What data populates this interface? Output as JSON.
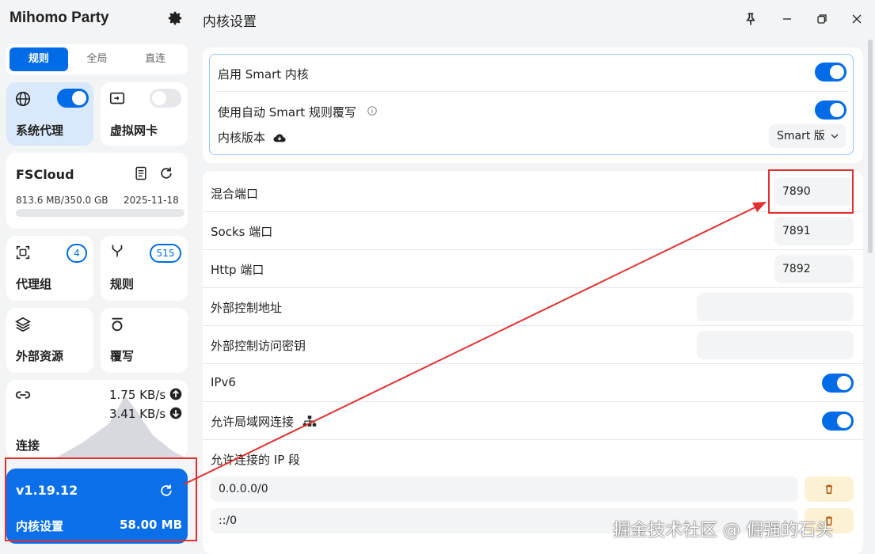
{
  "app": {
    "brand": "Mihomo Party"
  },
  "modes": [
    "规则",
    "全局",
    "直连"
  ],
  "cards": {
    "system_proxy": "系统代理",
    "tun": "虚拟网卡",
    "profile": {
      "name": "FSCloud",
      "usage": "813.6 MB/350.0 GB",
      "date": "2025-11-18",
      "progress": 0.0
    },
    "proxy_groups": {
      "label": "代理组",
      "count": "4"
    },
    "rules": {
      "label": "规则",
      "count": "515"
    },
    "resources": "外部资源",
    "override": "覆写",
    "connections": {
      "label": "连接",
      "up": "1.75 KB/s",
      "down": "3.41 KB/s"
    },
    "core": {
      "version": "v1.19.12",
      "label": "内核设置",
      "memory": "58.00 MB"
    }
  },
  "page": {
    "title": "内核设置"
  },
  "smart": {
    "enable": "启用 Smart 内核",
    "auto_override": "使用自动 Smart 规则覆写",
    "core_version_label": "内核版本",
    "core_version_value": "Smart 版"
  },
  "settings": {
    "mixed_port": {
      "label": "混合端口",
      "value": "7890"
    },
    "socks_port": {
      "label": "Socks 端口",
      "value": "7891"
    },
    "http_port": {
      "label": "Http 端口",
      "value": "7892"
    },
    "external_controller": {
      "label": "外部控制地址",
      "value": ""
    },
    "external_secret": {
      "label": "外部控制访问密钥",
      "value": ""
    },
    "ipv6": {
      "label": "IPv6"
    },
    "allow_lan": {
      "label": "允许局域网连接"
    },
    "allowed_ips": {
      "label": "允许连接的 IP 段",
      "items": [
        "0.0.0.0/0",
        "::/0"
      ]
    }
  },
  "watermark": "掘金技术社区 @ 倔强的石头",
  "colors": {
    "accent": "#006be6",
    "highlight": "#e03131"
  }
}
